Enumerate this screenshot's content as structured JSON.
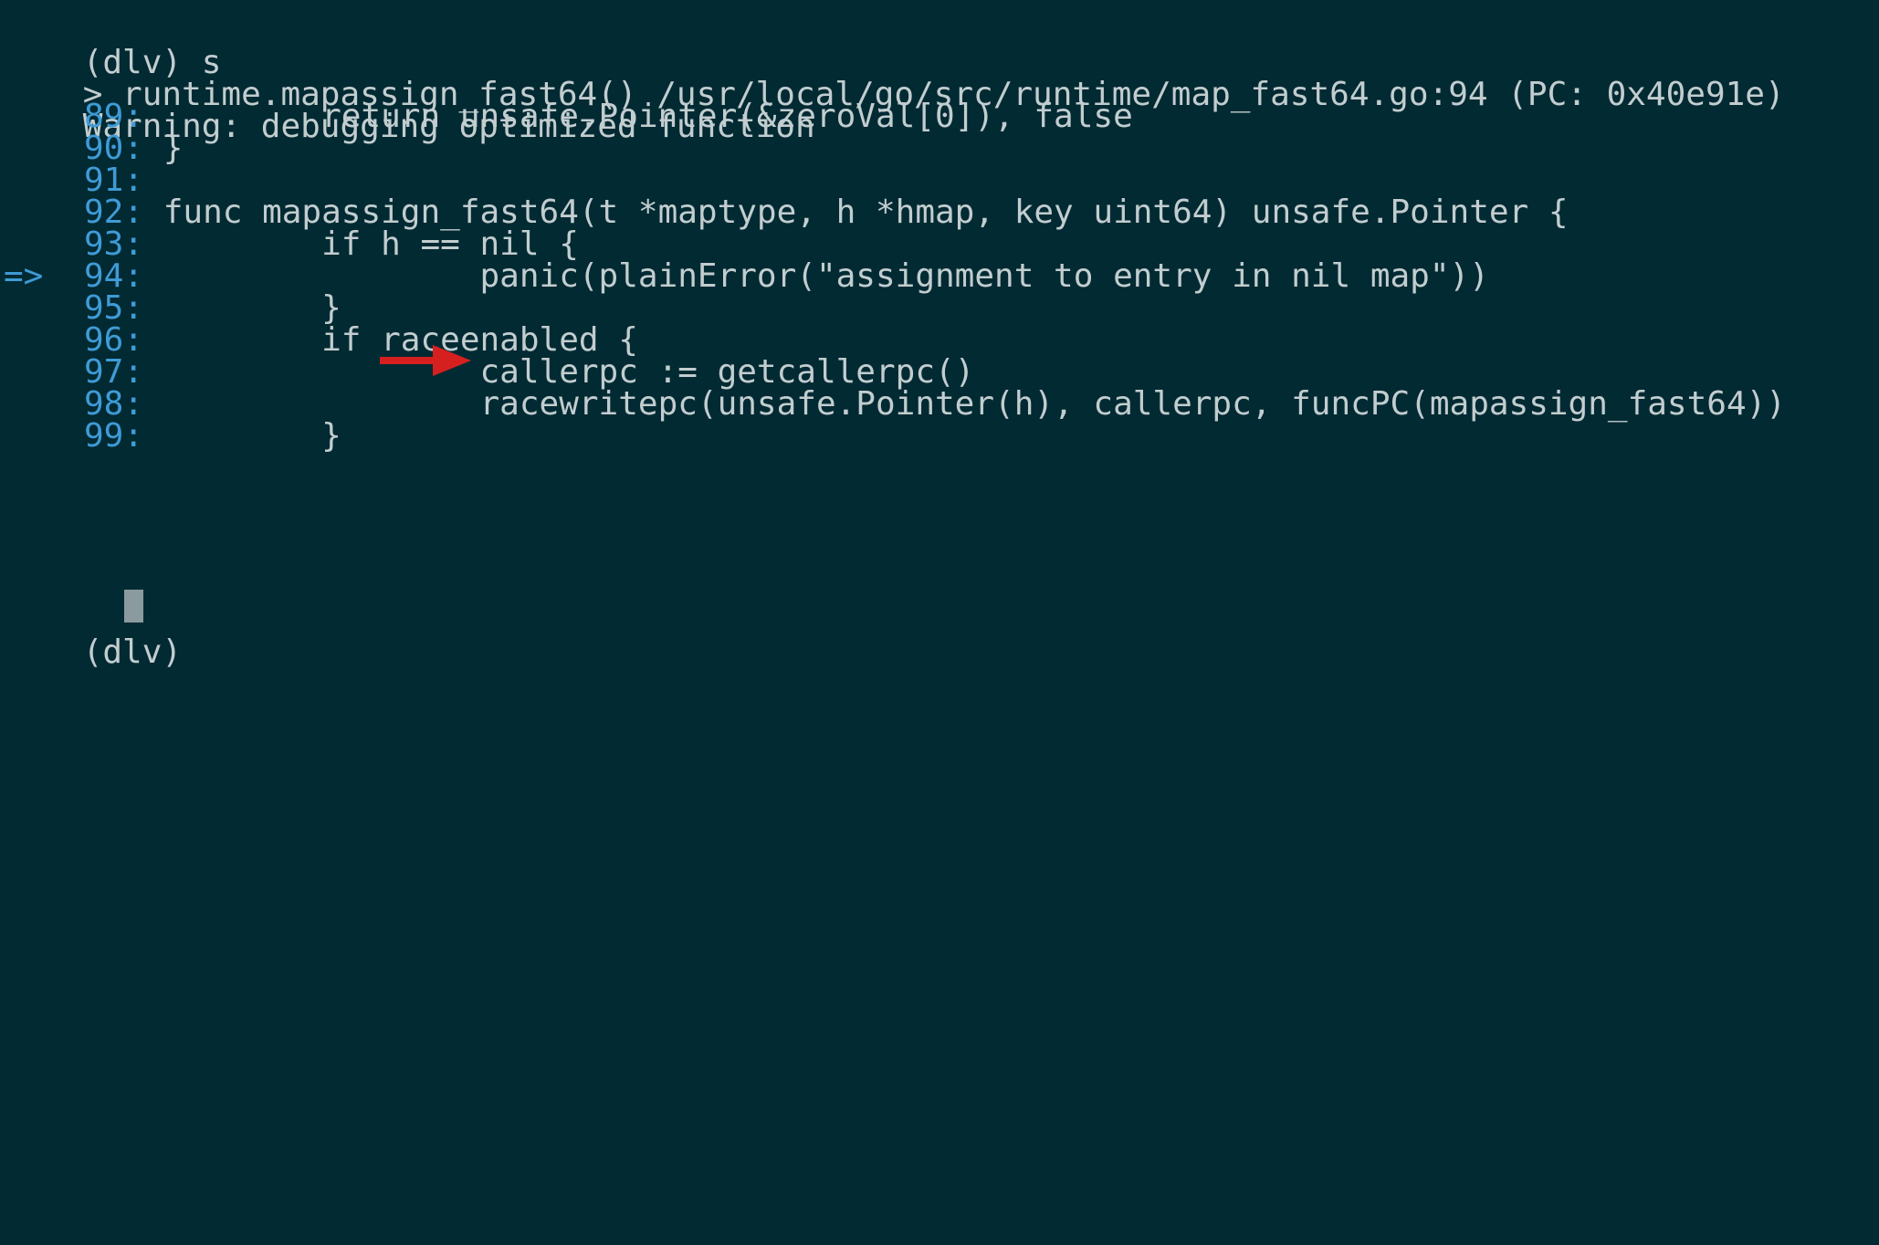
{
  "terminal": {
    "lines": [
      {
        "text": "(dlv) s"
      },
      {
        "text": "> runtime.mapassign_fast64() /usr/local/go/src/runtime/map_fast64.go:94 (PC: 0x40e91e)"
      },
      {
        "text": "Warning: debugging optimized function"
      },
      {
        "marker": "",
        "num": "89:",
        "code": "        return unsafe.Pointer(&zeroVal[0]), false"
      },
      {
        "marker": "",
        "num": "90:",
        "code": "}"
      },
      {
        "marker": "",
        "num": "91:",
        "code": ""
      },
      {
        "marker": "",
        "num": "92:",
        "code": "func mapassign_fast64(t *maptype, h *hmap, key uint64) unsafe.Pointer {"
      },
      {
        "marker": "",
        "num": "93:",
        "code": "        if h == nil {"
      },
      {
        "marker": "=>",
        "num": "94:",
        "code": "                panic(plainError(\"assignment to entry in nil map\"))"
      },
      {
        "marker": "",
        "num": "95:",
        "code": "        }"
      },
      {
        "marker": "",
        "num": "96:",
        "code": "        if raceenabled {"
      },
      {
        "marker": "",
        "num": "97:",
        "code": "                callerpc := getcallerpc()"
      },
      {
        "marker": "",
        "num": "98:",
        "code": "                racewritepc(unsafe.Pointer(h), callerpc, funcPC(mapassign_fast64))"
      },
      {
        "marker": "",
        "num": "99:",
        "code": "        }"
      }
    ],
    "prompt": "(dlv)"
  },
  "colors": {
    "background": "#022a33",
    "text": "#c2cdcf",
    "line_number": "#3f9bd6",
    "annotation_arrow": "#d62020",
    "cursor": "#8b9a9e"
  },
  "icons": {
    "annotation": "red-right-arrow-icon"
  }
}
